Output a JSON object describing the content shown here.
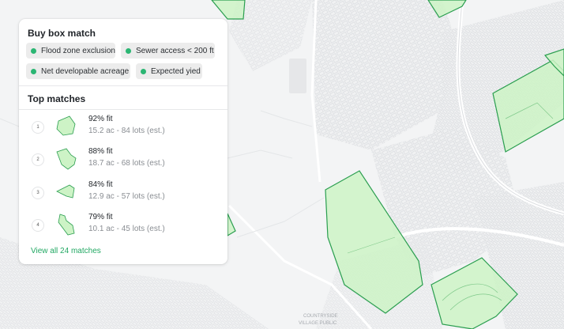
{
  "colors": {
    "accent_green": "#2bb673",
    "parcel_fill": "#cdf3c6",
    "parcel_stroke": "#2a9e4f",
    "link_green": "#22a863"
  },
  "map": {
    "labels": [
      "COUNTRYSIDE",
      "VILLAGE PUBLIC"
    ]
  },
  "buy_box": {
    "title": "Buy box match",
    "criteria": [
      {
        "label": "Flood zone exclusion",
        "icon": "status-dot"
      },
      {
        "label": "Sewer access < 200 ft",
        "icon": "status-dot"
      },
      {
        "label": "Net developable acreage",
        "icon": "status-dot"
      },
      {
        "label": "Expected yied",
        "icon": "status-dot"
      }
    ]
  },
  "top_matches": {
    "title": "Top matches",
    "items": [
      {
        "rank": "1",
        "fit": "92% fit",
        "details": "15.2 ac - 84 lots (est.)",
        "icon": "parcel-shape-icon"
      },
      {
        "rank": "2",
        "fit": "88% fit",
        "details": "18.7 ac - 68 lots (est.)",
        "icon": "parcel-shape-icon"
      },
      {
        "rank": "3",
        "fit": "84% fit",
        "details": "12.9 ac - 57 lots (est.)",
        "icon": "parcel-shape-icon"
      },
      {
        "rank": "4",
        "fit": "79% fit",
        "details": "10.1 ac - 45 lots (est.)",
        "icon": "parcel-shape-icon"
      }
    ],
    "view_all": "View all 24 matches"
  }
}
